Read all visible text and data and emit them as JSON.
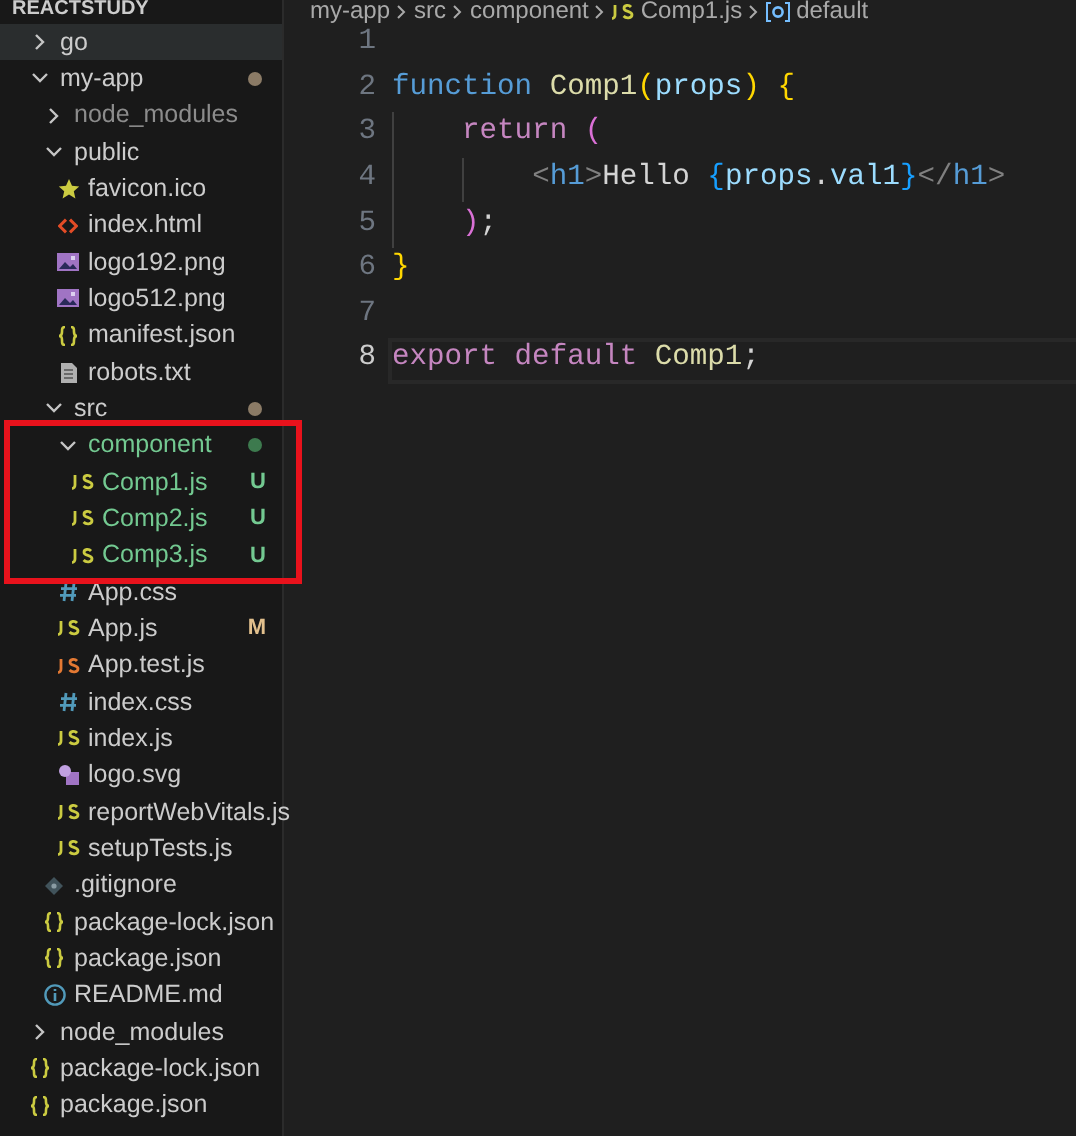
{
  "explorer": {
    "title": "REACTSTUDY",
    "items": [
      {
        "name": "go",
        "kind": "folder",
        "expanded": false,
        "selected": true
      },
      {
        "name": "my-app",
        "kind": "folder",
        "expanded": true,
        "selected": false,
        "color": "#8b7b66",
        "children": [
          {
            "name": "node_modules",
            "kind": "folder",
            "expanded": false,
            "selected": false,
            "ignored": true
          },
          {
            "name": "public",
            "kind": "folder",
            "expanded": true,
            "selected": false,
            "children": [
              {
                "name": "favicon.ico",
                "kind": "star",
                "selected": false
              },
              {
                "name": "index.html",
                "kind": "html",
                "selected": false
              },
              {
                "name": "logo192.png",
                "kind": "image",
                "selected": false
              },
              {
                "name": "logo512.png",
                "kind": "image",
                "selected": false
              },
              {
                "name": "manifest.json",
                "kind": "json",
                "selected": false
              },
              {
                "name": "robots.txt",
                "kind": "text",
                "selected": false
              }
            ]
          },
          {
            "name": "src",
            "kind": "folder",
            "expanded": true,
            "selected": false,
            "color": "#8b7b66",
            "children": [
              {
                "name": "component",
                "kind": "folder",
                "expanded": true,
                "selected": false,
                "untracked": true,
                "color": "#3d7a4e",
                "boxed": true,
                "children": [
                  {
                    "name": "Comp1.js",
                    "kind": "js",
                    "selected": false,
                    "untracked": true,
                    "badge": "U"
                  },
                  {
                    "name": "Comp2.js",
                    "kind": "js",
                    "selected": false,
                    "untracked": true,
                    "badge": "U"
                  },
                  {
                    "name": "Comp3.js",
                    "kind": "js",
                    "selected": false,
                    "untracked": true,
                    "badge": "U"
                  }
                ]
              },
              {
                "name": "App.css",
                "kind": "css",
                "selected": false
              },
              {
                "name": "App.js",
                "kind": "js",
                "selected": false,
                "modified": true,
                "badge": "M"
              },
              {
                "name": "App.test.js",
                "kind": "testjs",
                "selected": false
              },
              {
                "name": "index.css",
                "kind": "css",
                "selected": false
              },
              {
                "name": "index.js",
                "kind": "js",
                "selected": false
              },
              {
                "name": "logo.svg",
                "kind": "svg",
                "selected": false
              },
              {
                "name": "reportWebVitals.js",
                "kind": "js",
                "selected": false
              },
              {
                "name": "setupTests.js",
                "kind": "js",
                "selected": false
              }
            ]
          },
          {
            "name": ".gitignore",
            "kind": "git",
            "selected": false
          },
          {
            "name": "package-lock.json",
            "kind": "json",
            "selected": false
          },
          {
            "name": "package.json",
            "kind": "json",
            "selected": false
          },
          {
            "name": "README.md",
            "kind": "info",
            "selected": false
          }
        ]
      },
      {
        "name": "node_modules",
        "kind": "folder",
        "expanded": false,
        "selected": false
      },
      {
        "name": "package-lock.json",
        "kind": "json",
        "selected": false
      },
      {
        "name": "package.json",
        "kind": "json",
        "selected": false
      }
    ]
  },
  "breadcrumbs": [
    {
      "label": "my-app",
      "kind": "plain"
    },
    {
      "label": "src",
      "kind": "plain"
    },
    {
      "label": "component",
      "kind": "plain"
    },
    {
      "label": "Comp1.js",
      "kind": "js"
    },
    {
      "label": "default",
      "kind": "symbol"
    }
  ],
  "editor": {
    "lines": [
      {
        "number": "1",
        "current": false
      },
      {
        "number": "2",
        "current": false,
        "tokens": [
          {
            "kind": "storage",
            "text": "function "
          },
          {
            "kind": "func",
            "text": "Comp1"
          },
          {
            "kind": "bracket1",
            "text": "("
          },
          {
            "kind": "var",
            "text": "props"
          },
          {
            "kind": "bracket1",
            "text": ") {"
          }
        ]
      },
      {
        "number": "3",
        "current": false,
        "tokens": [
          {
            "kind": "control",
            "text": "    return "
          },
          {
            "kind": "bracket2",
            "text": "("
          }
        ]
      },
      {
        "number": "4",
        "current": false,
        "tokens": [
          {
            "kind": "tagpunct",
            "text": "        <"
          },
          {
            "kind": "tag",
            "text": "h1"
          },
          {
            "kind": "tagpunct",
            "text": ">"
          },
          {
            "kind": "plain",
            "text": "Hello "
          },
          {
            "kind": "bracket3",
            "text": "{"
          },
          {
            "kind": "var",
            "text": "props"
          },
          {
            "kind": "plain",
            "text": "."
          },
          {
            "kind": "var",
            "text": "val1"
          },
          {
            "kind": "bracket3",
            "text": "}"
          },
          {
            "kind": "tagpunct",
            "text": "</"
          },
          {
            "kind": "tag",
            "text": "h1"
          },
          {
            "kind": "tagpunct",
            "text": ">"
          }
        ]
      },
      {
        "number": "5",
        "current": false,
        "tokens": [
          {
            "kind": "bracket2",
            "text": "    )"
          },
          {
            "kind": "plain",
            "text": ";"
          }
        ]
      },
      {
        "number": "6",
        "current": false,
        "tokens": [
          {
            "kind": "bracket1",
            "text": "}"
          }
        ]
      },
      {
        "number": "7",
        "current": false
      },
      {
        "number": "8",
        "current": true,
        "tokens": [
          {
            "kind": "control",
            "text": "export default "
          },
          {
            "kind": "func",
            "text": "Comp1"
          },
          {
            "kind": "plain",
            "text": ";"
          }
        ]
      }
    ]
  }
}
